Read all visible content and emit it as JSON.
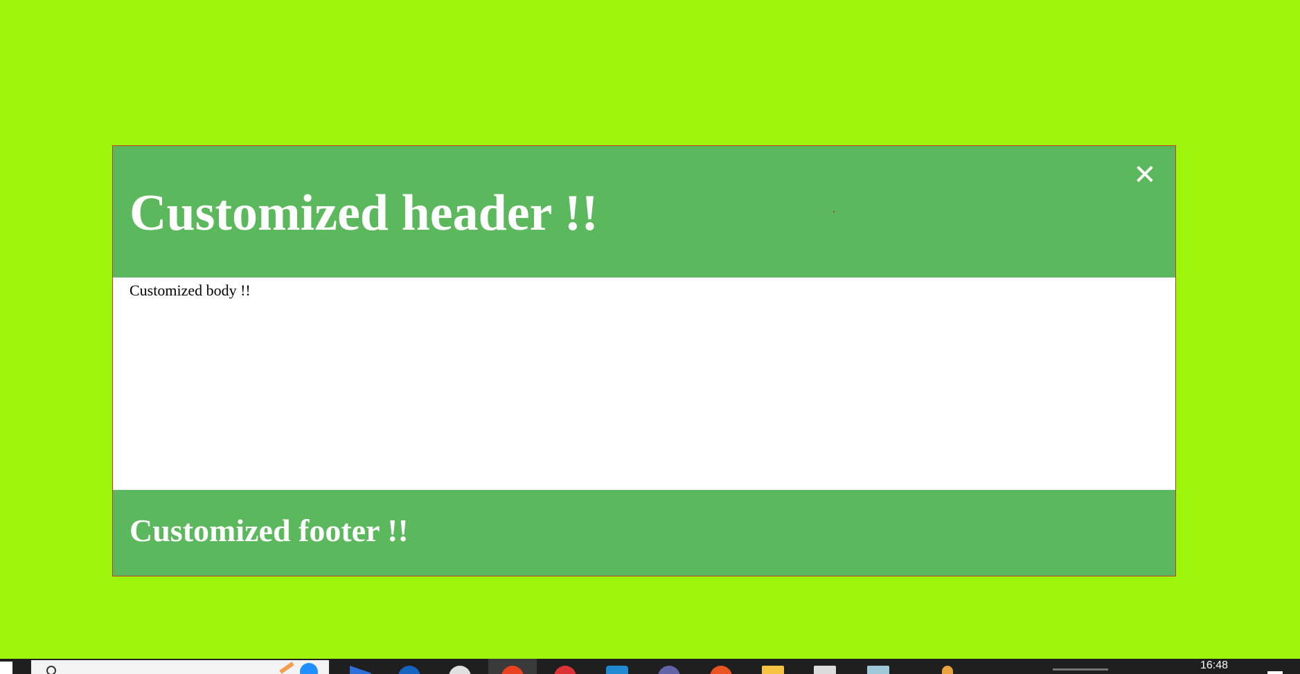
{
  "page": {
    "background": "#9ef50b"
  },
  "modal": {
    "header_title": "Customized header !!",
    "close_glyph": "✕",
    "body_text": "Customized body !!",
    "footer_title": "Customized footer !!",
    "accent": "#5cb85c",
    "border": "#c0392b"
  },
  "taskbar": {
    "clock": "16:48",
    "icons": [
      "start-icon",
      "search-icon",
      "pencil-icon",
      "chat-bubble-icon",
      "play-icon",
      "edge-icon",
      "clock-app-icon",
      "brave-icon",
      "chrome-icon",
      "vscode-icon",
      "teams-icon",
      "ubuntu-icon",
      "folder-icon",
      "notepad-icon",
      "files-icon",
      "user-icon"
    ]
  }
}
